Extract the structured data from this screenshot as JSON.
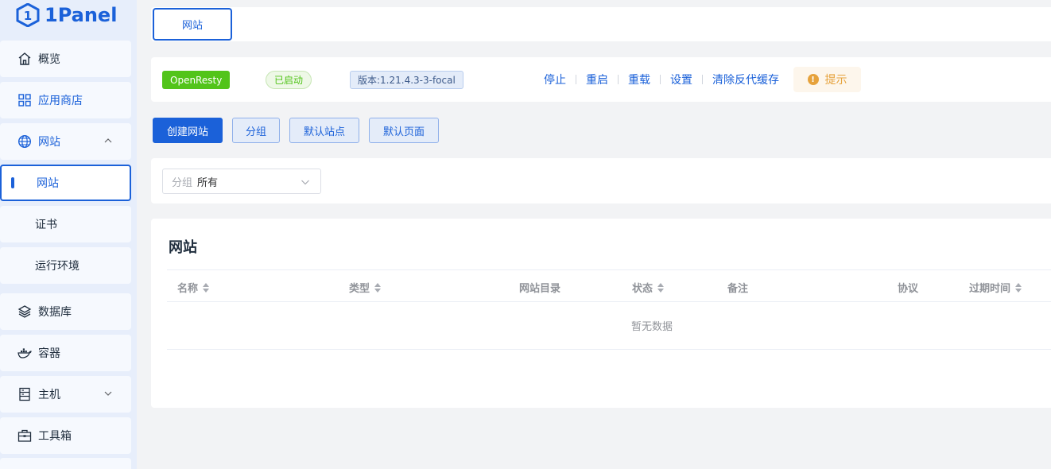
{
  "app": {
    "logo_text": "1Panel"
  },
  "sidebar": {
    "items": [
      {
        "label": "概览",
        "icon": "home-icon"
      },
      {
        "label": "应用商店",
        "icon": "grid-icon"
      },
      {
        "label": "网站",
        "icon": "globe-icon",
        "expanded": true
      },
      {
        "label": "网站",
        "active": true
      },
      {
        "label": "证书"
      },
      {
        "label": "运行环境"
      },
      {
        "label": "数据库",
        "icon": "layers-icon"
      },
      {
        "label": "容器",
        "icon": "docker-icon"
      },
      {
        "label": "主机",
        "icon": "server-icon"
      },
      {
        "label": "工具箱",
        "icon": "toolbox-icon"
      }
    ]
  },
  "tabs": [
    {
      "label": "网站",
      "active": true
    }
  ],
  "status": {
    "app_name": "OpenResty",
    "state": "已启动",
    "version": "版本:1.21.4.3-3-focal",
    "actions": [
      "停止",
      "重启",
      "重载",
      "设置",
      "清除反代缓存"
    ],
    "tip": "提示"
  },
  "toolbar": {
    "create": "创建网站",
    "group": "分组",
    "default_site": "默认站点",
    "default_page": "默认页面"
  },
  "filter": {
    "prefix": "分组",
    "value": "所有"
  },
  "table": {
    "title": "网站",
    "columns": [
      "名称",
      "类型",
      "网站目录",
      "状态",
      "备注",
      "协议",
      "过期时间"
    ],
    "empty_text": "暂无数据"
  },
  "colors": {
    "primary": "#1b61d9",
    "success": "#52c41a",
    "warning": "#e6a23c"
  }
}
